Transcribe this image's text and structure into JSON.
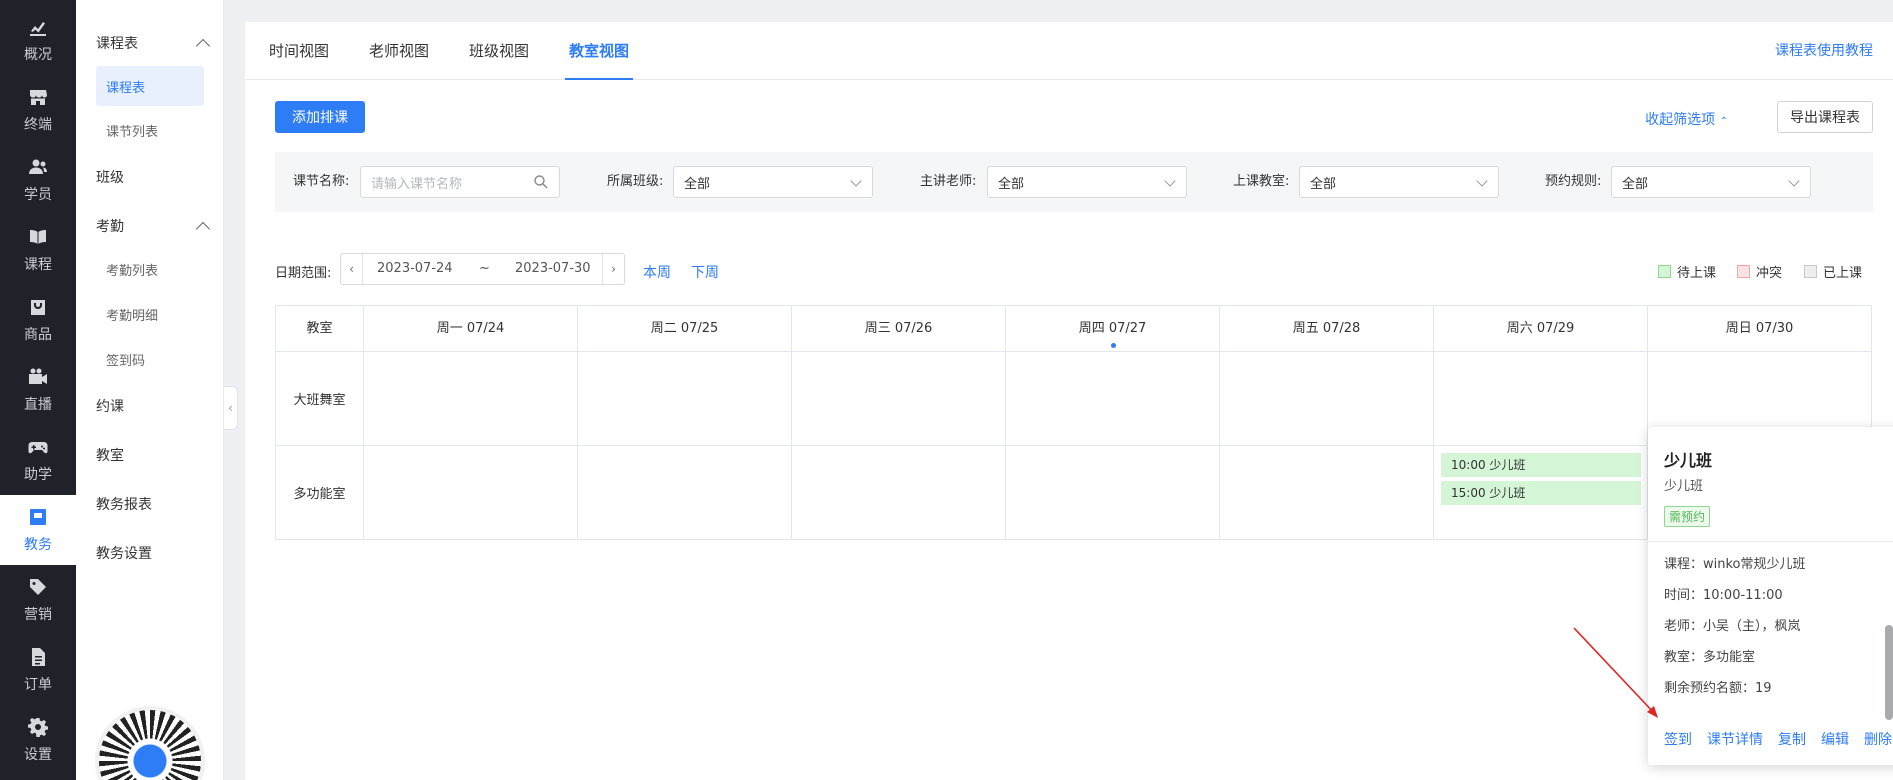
{
  "nav": {
    "items": [
      {
        "label": "概况",
        "icon": "chart-icon"
      },
      {
        "label": "终端",
        "icon": "store-icon"
      },
      {
        "label": "学员",
        "icon": "users-icon"
      },
      {
        "label": "课程",
        "icon": "book-icon"
      },
      {
        "label": "商品",
        "icon": "bag-icon"
      },
      {
        "label": "直播",
        "icon": "video-icon"
      },
      {
        "label": "助学",
        "icon": "gamepad-icon"
      },
      {
        "label": "教务",
        "icon": "calendar-icon"
      },
      {
        "label": "营销",
        "icon": "tag-icon"
      },
      {
        "label": "订单",
        "icon": "document-icon"
      },
      {
        "label": "设置",
        "icon": "gear-icon"
      }
    ],
    "active": "教务"
  },
  "sidebar": {
    "schedule_group": "课程表",
    "schedule_items": [
      "课程表",
      "课节列表"
    ],
    "class": "班级",
    "attendance_group": "考勤",
    "attendance_items": [
      "考勤列表",
      "考勤明细",
      "签到码"
    ],
    "booking": "约课",
    "classroom": "教室",
    "report": "教务报表",
    "settings": "教务设置"
  },
  "tabs": [
    "时间视图",
    "老师视图",
    "班级视图",
    "教室视图"
  ],
  "active_tab": "教室视图",
  "help_link": "课程表使用教程",
  "toolbar": {
    "add_button": "添加排课",
    "collapse_filter": "收起筛选项",
    "export_button": "导出课程表"
  },
  "filters": {
    "lesson_name": {
      "label": "课节名称:",
      "placeholder": "请输入课节名称"
    },
    "class": {
      "label": "所属班级:",
      "value": "全部"
    },
    "teacher": {
      "label": "主讲老师:",
      "value": "全部"
    },
    "classroom": {
      "label": "上课教室:",
      "value": "全部"
    },
    "rule": {
      "label": "预约规则:",
      "value": "全部"
    }
  },
  "date": {
    "label": "日期范围:",
    "start": "2023-07-24",
    "sep": "~",
    "end": "2023-07-30",
    "this_week": "本周",
    "next_week": "下周"
  },
  "legend": [
    {
      "label": "待上课",
      "color": "#d4f5d6",
      "border": "#8fd68f"
    },
    {
      "label": "冲突",
      "color": "#fde2e2",
      "border": "#f3a6a6"
    },
    {
      "label": "已上课",
      "color": "#eeeeee",
      "border": "#c8c8c8"
    }
  ],
  "grid": {
    "room_header": "教室",
    "days": [
      "周一 07/24",
      "周二 07/25",
      "周三 07/26",
      "周四 07/27",
      "周五 07/28",
      "周六 07/29",
      "周日 07/30"
    ],
    "today_index": 3,
    "rooms": [
      "大班舞室",
      "多功能室"
    ],
    "events": [
      {
        "room": 1,
        "day": 5,
        "text": "10:00  少儿班"
      },
      {
        "room": 1,
        "day": 5,
        "text": "15:00  少儿班"
      }
    ]
  },
  "popover": {
    "title": "少儿班",
    "subtitle": "少儿班",
    "badge": "需预约",
    "course": "课程：winko常规少儿班",
    "time": "时间：10:00-11:00",
    "teacher": "老师：小吴（主），枫岚",
    "room": "教室：多功能室",
    "remaining": "剩余预约名额：19",
    "actions": [
      "签到",
      "课节详情",
      "复制",
      "编辑",
      "删除"
    ]
  },
  "colors": {
    "accent": "#2e7cf6",
    "nav_bg": "#1f2329",
    "event_bg": "#d4f5d6"
  }
}
